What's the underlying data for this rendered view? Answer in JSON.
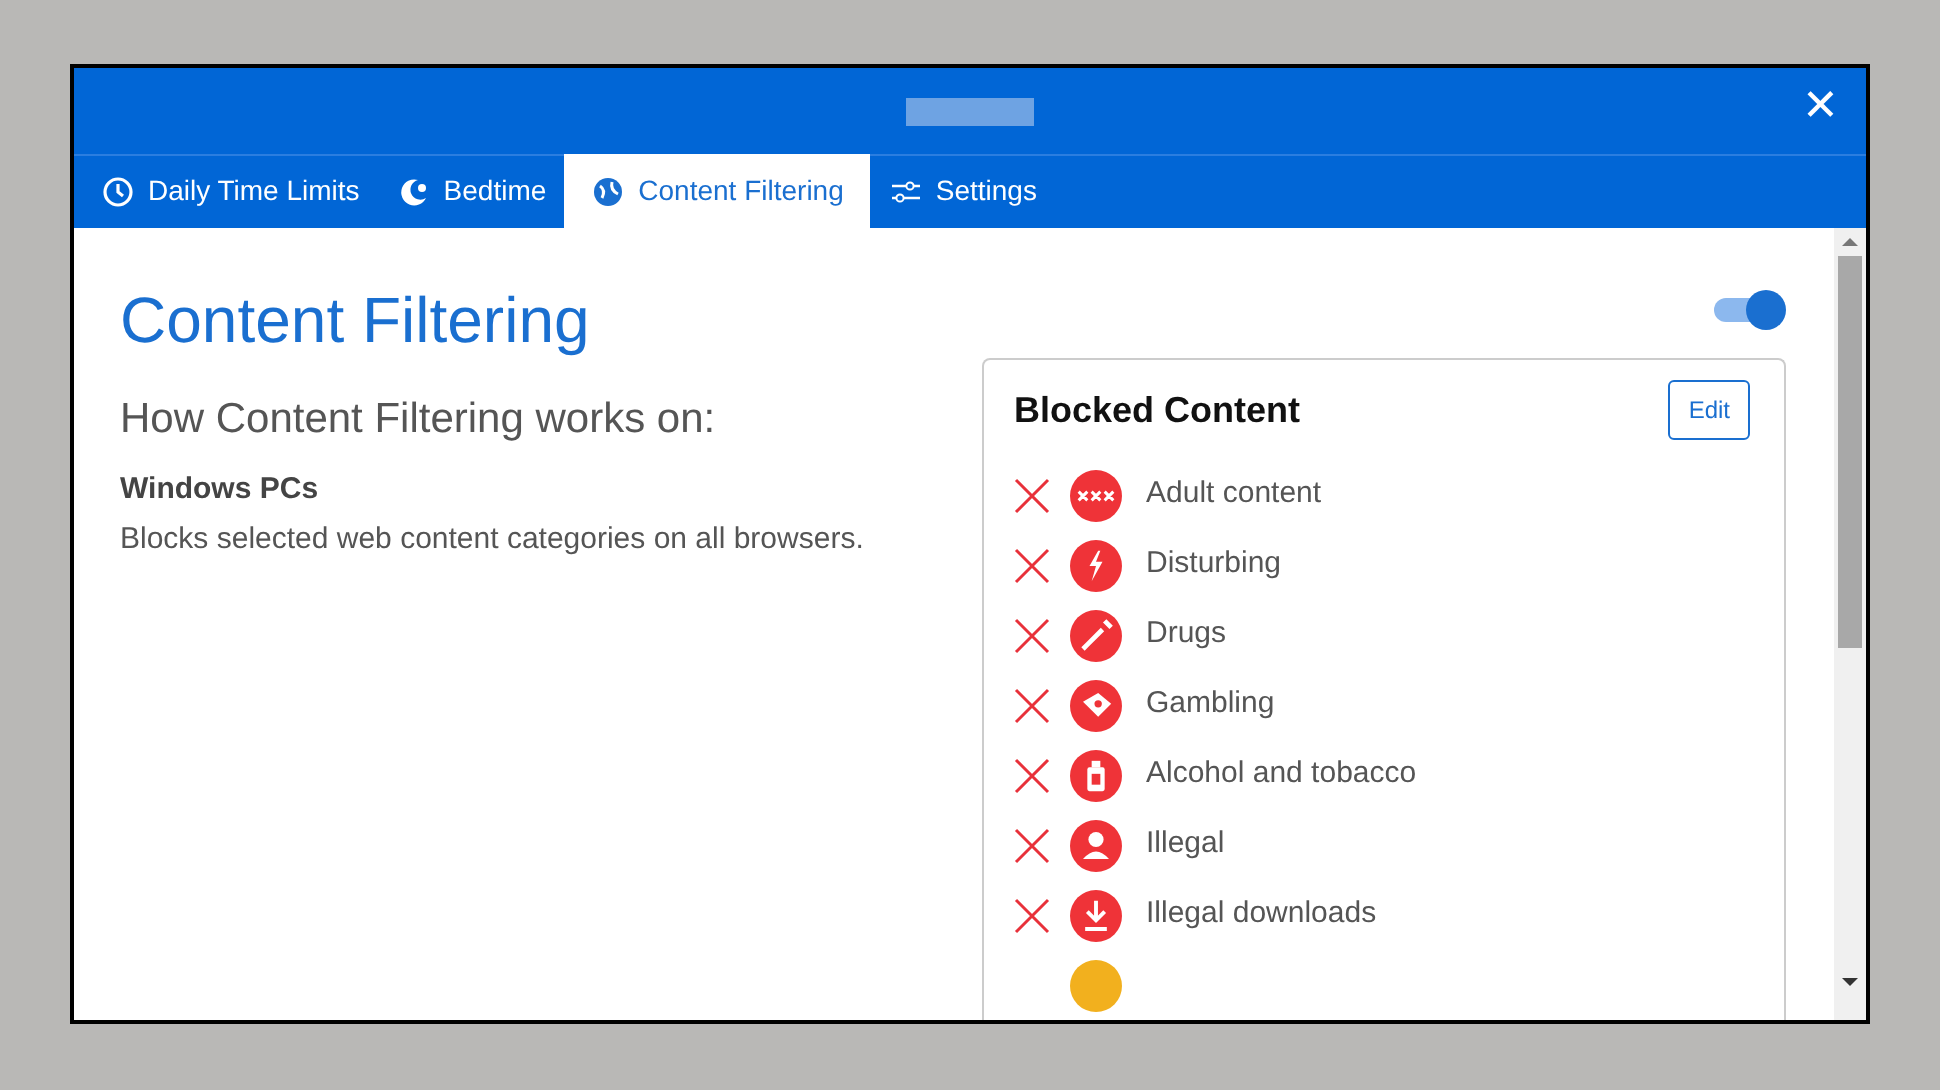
{
  "window": {
    "close": "✕"
  },
  "tabs": [
    {
      "label": "Daily Time Limits",
      "selected": false
    },
    {
      "label": "Bedtime",
      "selected": false
    },
    {
      "label": "Content Filtering",
      "selected": true
    },
    {
      "label": "Settings",
      "selected": false
    }
  ],
  "page": {
    "heading": "Content Filtering",
    "enabled": true,
    "subheading": "How Content Filtering works on:",
    "platform": "Windows PCs",
    "description": "Blocks selected web content categories on all browsers."
  },
  "blocked_content": {
    "title": "Blocked Content",
    "edit_button": "Edit",
    "items": [
      {
        "label": "Adult content",
        "color": "#ef3338"
      },
      {
        "label": "Disturbing",
        "color": "#ef3338"
      },
      {
        "label": "Drugs",
        "color": "#ef3338"
      },
      {
        "label": "Gambling",
        "color": "#ef3338"
      },
      {
        "label": "Alcohol and tobacco",
        "color": "#ef3338"
      },
      {
        "label": "Illegal",
        "color": "#ef3338"
      },
      {
        "label": "Illegal downloads",
        "color": "#ef3338"
      },
      {
        "color": "#f2b01e"
      }
    ]
  }
}
